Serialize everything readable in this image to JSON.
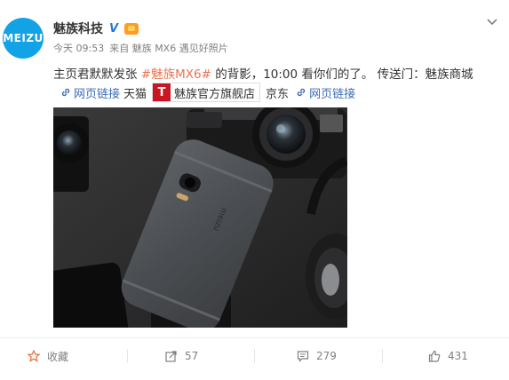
{
  "post": {
    "author": "魅族科技",
    "avatar_text": "MEIZU",
    "time": "今天 09:53",
    "source": "来自 魅族 MX6 遇见好照片",
    "text_before": "主页君默默发张 ",
    "hashtag": "#魅族MX6#",
    "text_after": " 的背影，10:00 看你们的了。 传送门：魅族商城",
    "links": {
      "link1": "网页链接",
      "tmall_label": "天猫",
      "shop_letter": "T",
      "shop_name": "魅族官方旗舰店",
      "jd_label": "京东",
      "link2": "网页链接"
    }
  },
  "footer": {
    "favorite_label": "收藏",
    "repost_count": "57",
    "comment_count": "279",
    "like_count": "431"
  },
  "colors": {
    "avatar": "#11a3e6",
    "link": "#3a6db5",
    "hashtag": "#eb7350",
    "shop_badge": "#c81623"
  },
  "icons": [
    "chevron-down-icon",
    "verified-icon",
    "vip-icon",
    "link-icon",
    "star-icon",
    "repost-icon",
    "comment-icon",
    "like-icon"
  ]
}
